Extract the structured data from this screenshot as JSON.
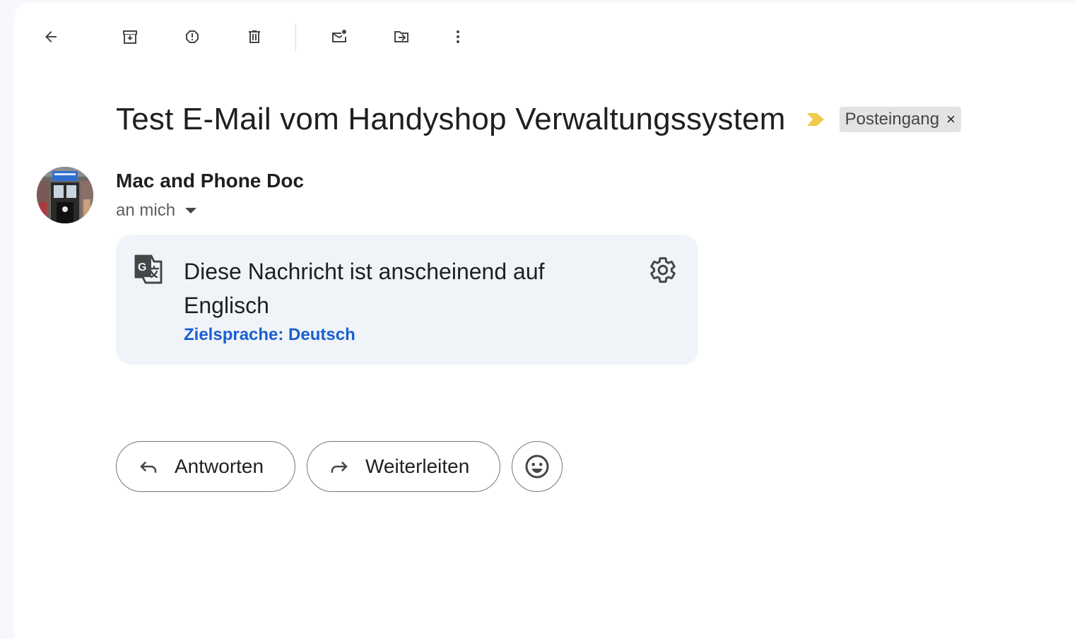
{
  "toolbar": {
    "back": "back-arrow-icon",
    "archive": "archive-icon",
    "spam": "report-spam-icon",
    "delete": "trash-icon",
    "mark_unread": "mark-unread-icon",
    "move_to": "move-to-folder-icon",
    "more": "more-vert-icon"
  },
  "email": {
    "subject": "Test E-Mail vom Handyshop Verwaltungssystem",
    "label": "Posteingang",
    "label_remove": "×",
    "important_color": "#f2c94c",
    "sender": "Mac and Phone Doc",
    "recipient": "an mich"
  },
  "translate_banner": {
    "message": "Diese Nachricht ist anscheinend auf Englisch",
    "target_language": "Zielsprache: Deutsch",
    "link_color": "#1a5fd0"
  },
  "actions": {
    "reply": "Antworten",
    "forward": "Weiterleiten",
    "emoji": "emoji-reaction-icon"
  }
}
